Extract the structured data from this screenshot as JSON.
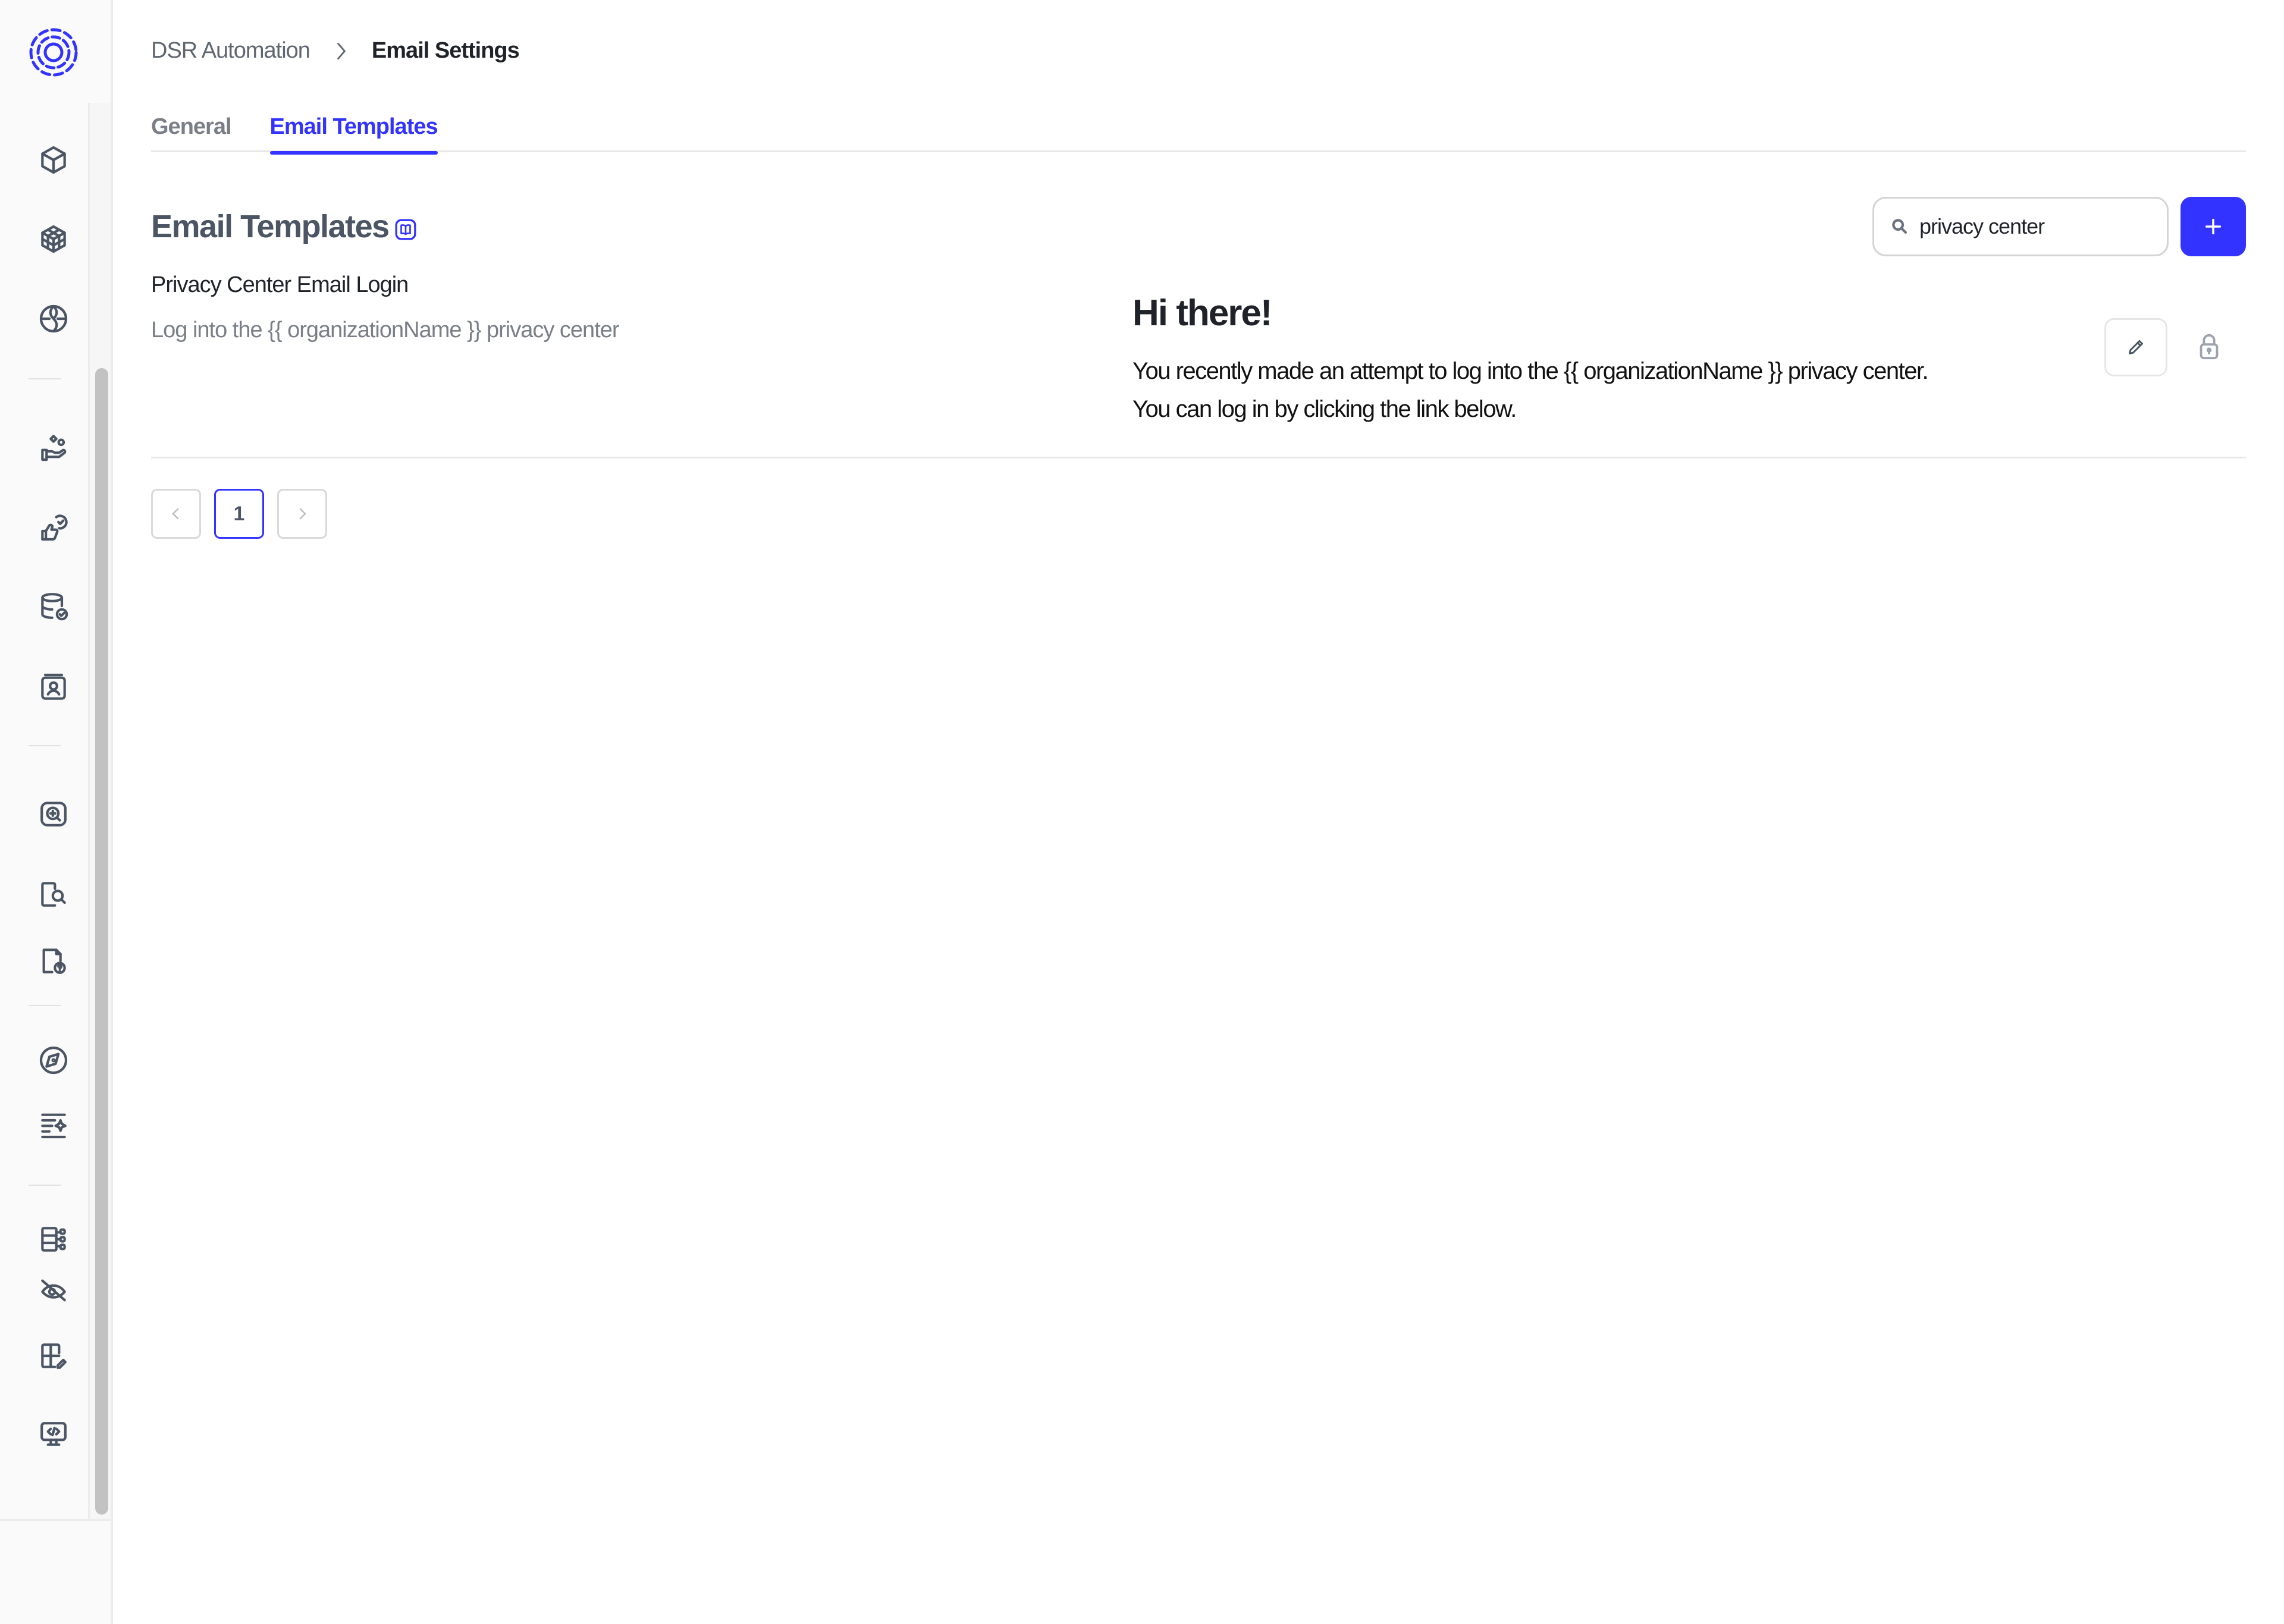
{
  "brand": {
    "accent": "#3333ff",
    "logo_icon": "dashed-rings-logo"
  },
  "sidebar": {
    "items": [
      {
        "id": "systems",
        "icon": "cube-icon"
      },
      {
        "id": "datasets",
        "icon": "rubiks-cube-icon"
      },
      {
        "id": "integrations",
        "icon": "globe-icon"
      },
      {
        "id": "consumers",
        "icon": "hand-with-shapes-icon"
      },
      {
        "id": "consent",
        "icon": "thumbs-up-check-icon"
      },
      {
        "id": "data-catalog",
        "icon": "database-check-icon"
      },
      {
        "id": "identity",
        "icon": "user-card-icon"
      },
      {
        "id": "discovery",
        "icon": "search-plus-square-icon"
      },
      {
        "id": "detection",
        "icon": "document-search-icon"
      },
      {
        "id": "dsr",
        "icon": "document-question-icon"
      },
      {
        "id": "explore",
        "icon": "compass-icon"
      },
      {
        "id": "ai-list",
        "icon": "list-sparkle-icon"
      },
      {
        "id": "taxonomy",
        "icon": "table-tree-icon"
      },
      {
        "id": "privacy-hidden",
        "icon": "eye-off-icon"
      },
      {
        "id": "layout-edit",
        "icon": "layout-pencil-icon"
      },
      {
        "id": "developer",
        "icon": "monitor-code-icon"
      }
    ]
  },
  "breadcrumb": {
    "parent": "DSR Automation",
    "current": "Email Settings"
  },
  "tabs": [
    {
      "label": "General",
      "active": false
    },
    {
      "label": "Email Templates",
      "active": true
    }
  ],
  "section": {
    "title": "Email Templates",
    "docs_icon": "book-icon",
    "search": {
      "value": "privacy center",
      "placeholder": "Search"
    },
    "add_icon": "plus-icon"
  },
  "templates": [
    {
      "title": "Privacy Center Email Login",
      "description": "Log into the {{ organizationName }} privacy center",
      "preview": {
        "heading": "Hi there!",
        "line1": "You recently made an attempt to log into the {{ organizationName }} privacy center.",
        "line2": "You can log in by clicking the link below."
      },
      "locked": true
    }
  ],
  "pagination": {
    "current_page": "1",
    "prev_disabled": true,
    "next_disabled": true
  }
}
